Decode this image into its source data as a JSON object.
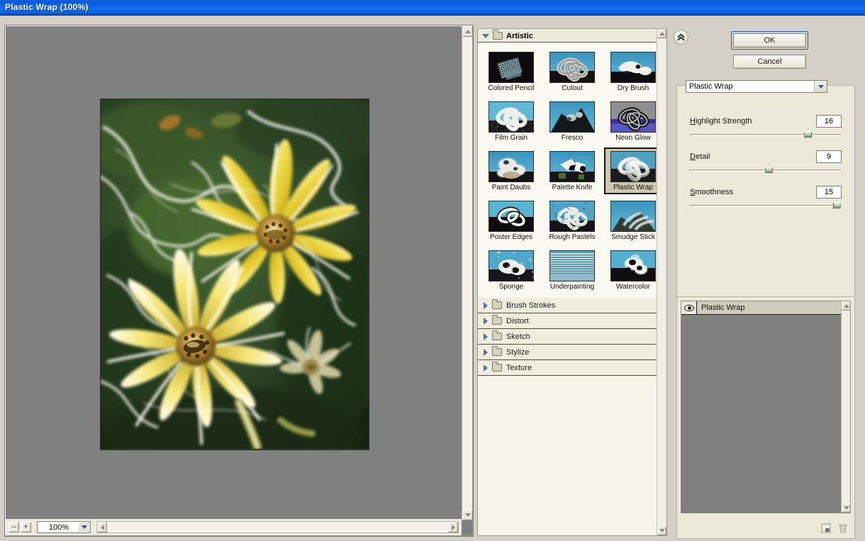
{
  "window": {
    "title": "Plastic Wrap (100%)"
  },
  "preview": {
    "zoom_out_label": "–",
    "zoom_in_label": "+",
    "zoom_level": "100%",
    "image_alt": "yellow daisy flowers with plastic wrap filter applied",
    "scroll_left_label": "‹",
    "scroll_right_label": "›",
    "scroll_up_label": "▲",
    "scroll_down_label": "▼"
  },
  "gallery": {
    "expanded_category": "Artistic",
    "filters": [
      {
        "label": "Colored Pencil",
        "icon": "thumb-colored-pencil",
        "selected": false
      },
      {
        "label": "Cutout",
        "icon": "thumb-cutout",
        "selected": false
      },
      {
        "label": "Dry Brush",
        "icon": "thumb-dry-brush",
        "selected": false
      },
      {
        "label": "Film Grain",
        "icon": "thumb-film-grain",
        "selected": false
      },
      {
        "label": "Fresco",
        "icon": "thumb-fresco",
        "selected": false
      },
      {
        "label": "Neon Glow",
        "icon": "thumb-neon-glow",
        "selected": false
      },
      {
        "label": "Paint Daubs",
        "icon": "thumb-paint-daubs",
        "selected": false
      },
      {
        "label": "Palette Knife",
        "icon": "thumb-palette-knife",
        "selected": false
      },
      {
        "label": "Plastic Wrap",
        "icon": "thumb-plastic-wrap",
        "selected": true
      },
      {
        "label": "Poster Edges",
        "icon": "thumb-poster-edges",
        "selected": false
      },
      {
        "label": "Rough Pastels",
        "icon": "thumb-rough-pastels",
        "selected": false
      },
      {
        "label": "Smudge Stick",
        "icon": "thumb-smudge-stick",
        "selected": false
      },
      {
        "label": "Sponge",
        "icon": "thumb-sponge",
        "selected": false
      },
      {
        "label": "Underpainting",
        "icon": "thumb-underpainting",
        "selected": false
      },
      {
        "label": "Watercolor",
        "icon": "thumb-watercolor",
        "selected": false
      }
    ],
    "categories": [
      {
        "label": "Brush Strokes",
        "expanded": false
      },
      {
        "label": "Distort",
        "expanded": false
      },
      {
        "label": "Sketch",
        "expanded": false
      },
      {
        "label": "Stylize",
        "expanded": false
      },
      {
        "label": "Texture",
        "expanded": false
      }
    ]
  },
  "panel": {
    "collapse_glyph": "«",
    "ok_label": "OK",
    "cancel_label": "Cancel",
    "selected_filter": "Plastic Wrap",
    "controls": [
      {
        "label": "Highlight Strength",
        "accel": "H",
        "value": "16",
        "percent": 78
      },
      {
        "label": "Detail",
        "accel": "D",
        "value": "9",
        "percent": 52
      },
      {
        "label": "Smoothness",
        "accel": "S",
        "value": "15",
        "percent": 97
      }
    ],
    "layers": [
      {
        "name": "Plastic Wrap",
        "visible": true
      }
    ],
    "new_layer_tooltip": "New effect layer",
    "delete_layer_tooltip": "Delete effect layer"
  },
  "colors": {
    "titlebar_blue": "#0d63e8",
    "panel_bg": "#ece9db",
    "gallery_bg": "#f7f5ea",
    "canvas_gray": "#808080",
    "selection_tan": "#cdc8ae",
    "slider_green": "#7ba07b",
    "accent_blue": "#2f5fb5"
  }
}
